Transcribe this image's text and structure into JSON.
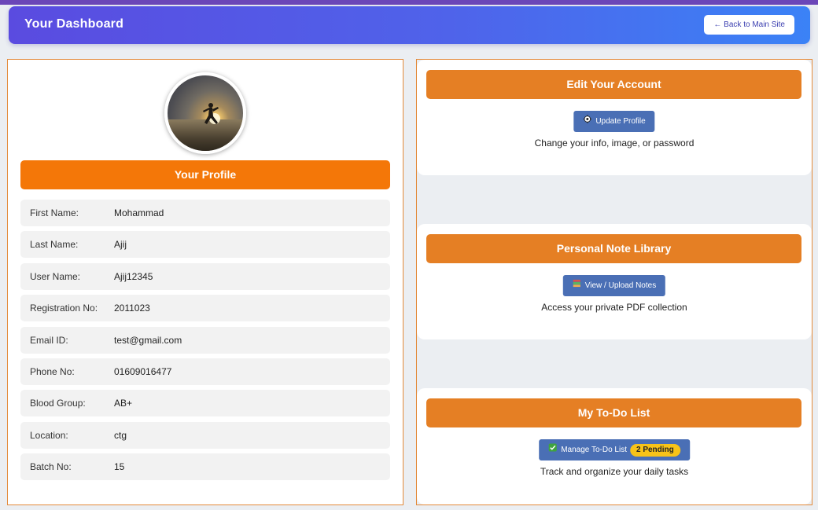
{
  "header": {
    "title": "Your Dashboard",
    "back_label": "← Back to Main Site"
  },
  "profile": {
    "heading": "Your Profile",
    "fields": [
      {
        "label": "First Name:",
        "value": "Mohammad"
      },
      {
        "label": "Last Name:",
        "value": "Ajij"
      },
      {
        "label": "User Name:",
        "value": "Ajij12345"
      },
      {
        "label": "Registration No:",
        "value": "2011023"
      },
      {
        "label": "Email ID:",
        "value": "test@gmail.com"
      },
      {
        "label": "Phone No:",
        "value": "01609016477"
      },
      {
        "label": "Blood Group:",
        "value": "AB+"
      },
      {
        "label": "Location:",
        "value": "ctg"
      },
      {
        "label": "Batch No:",
        "value": "15"
      }
    ]
  },
  "cards": {
    "account": {
      "heading": "Edit Your Account",
      "button": "Update Profile",
      "button_icon": "gear-icon",
      "description": "Change your info, image, or password"
    },
    "notes": {
      "heading": "Personal Note Library",
      "button": "View / Upload Notes",
      "button_icon": "books-icon",
      "description": "Access your private PDF collection"
    },
    "todo": {
      "heading": "My To-Do List",
      "button": "Manage To-Do List",
      "button_icon": "checkbox-icon",
      "badge": "2 Pending",
      "description": "Track and organize your daily tasks"
    }
  },
  "colors": {
    "accent_orange": "#f47708",
    "card_orange": "#e57f24",
    "button_blue": "#4a6fb5",
    "badge_yellow": "#f7c318"
  }
}
